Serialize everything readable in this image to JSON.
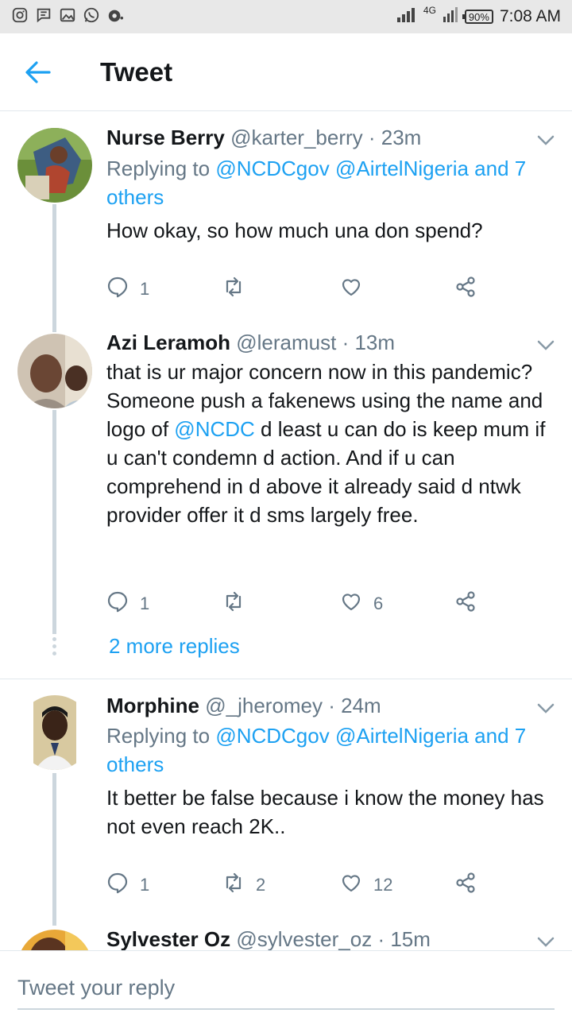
{
  "status_bar": {
    "network": "4G",
    "battery": "90%",
    "time": "7:08 AM",
    "icons": [
      "instagram-icon",
      "message-icon",
      "gallery-icon",
      "whatsapp-icon",
      "assistant-icon"
    ]
  },
  "header": {
    "title": "Tweet",
    "back_icon": "arrow-left-icon"
  },
  "tweets": [
    {
      "name": "Nurse Berry",
      "meta": "@karter_berry · 23m",
      "replying_prefix": "Replying to ",
      "replying_mentions": "@NCDCgov @AirtelNigeria and 7",
      "replying_others": "others",
      "text": "How okay, so how much una don spend?",
      "replies": "1",
      "retweets": "",
      "likes": ""
    },
    {
      "name": "Azi Leramoh",
      "meta": "@leramust · 13m",
      "text_1": "that is ur major concern now in this pandemic? Someone push a fakenews using the name and logo of ",
      "text_mention": "@NCDC",
      "text_2": " d least u can do is keep mum if u can't condemn d action. And if u can comprehend in d above it already said d ntwk provider offer it d sms largely free.",
      "replies": "1",
      "retweets": "",
      "likes": "6",
      "more_replies": "2 more replies"
    },
    {
      "name": "Morphine",
      "meta": "@_jheromey · 24m",
      "replying_prefix": "Replying to ",
      "replying_mentions": "@NCDCgov @AirtelNigeria and 7",
      "replying_others": "others",
      "text": "It better be false because i know the money has not even reach 2K..",
      "replies": "1",
      "retweets": "2",
      "likes": "12"
    },
    {
      "name": "Sylvester Oz",
      "meta": "@sylvester_oz · 15m"
    }
  ],
  "reply_bar": {
    "placeholder": "Tweet your reply"
  },
  "colors": {
    "accent": "#1da1f2",
    "text": "#14171a",
    "muted": "#657786",
    "divider": "#e1e8ed",
    "status_bar_bg": "#e8e8e8"
  }
}
